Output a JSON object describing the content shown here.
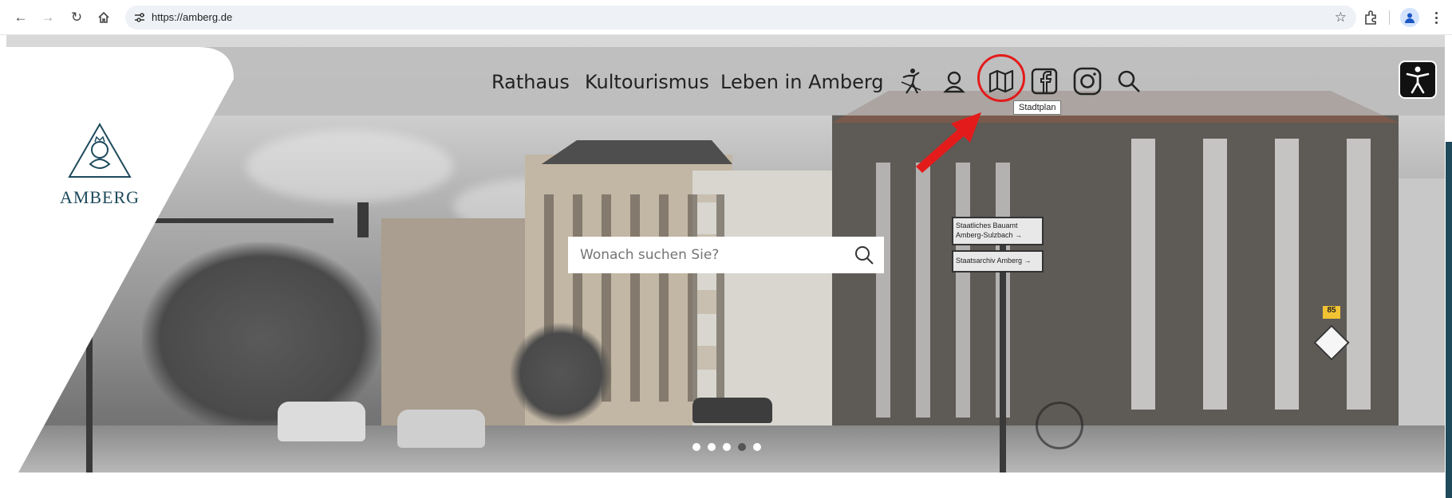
{
  "browser": {
    "url": "https://amberg.de"
  },
  "site": {
    "logo_text": "AMBERG",
    "nav": [
      "Rathaus",
      "Kultourismus",
      "Leben in Amberg"
    ],
    "header_icons": [
      "person-dancing-icon",
      "user-icon",
      "map-icon",
      "facebook-icon",
      "instagram-icon",
      "search-icon"
    ],
    "tooltip": "Stadtplan",
    "search_placeholder": "Wonach suchen Sie?",
    "slider_dots": 5,
    "active_dot": 3,
    "signs": [
      "Staatliches Bauamt Amberg-Sulzbach",
      "Staatsarchiv Amberg"
    ],
    "route_sign": "85"
  },
  "colors": {
    "brand": "#1e4a5c",
    "highlight": "#e31b1b"
  }
}
